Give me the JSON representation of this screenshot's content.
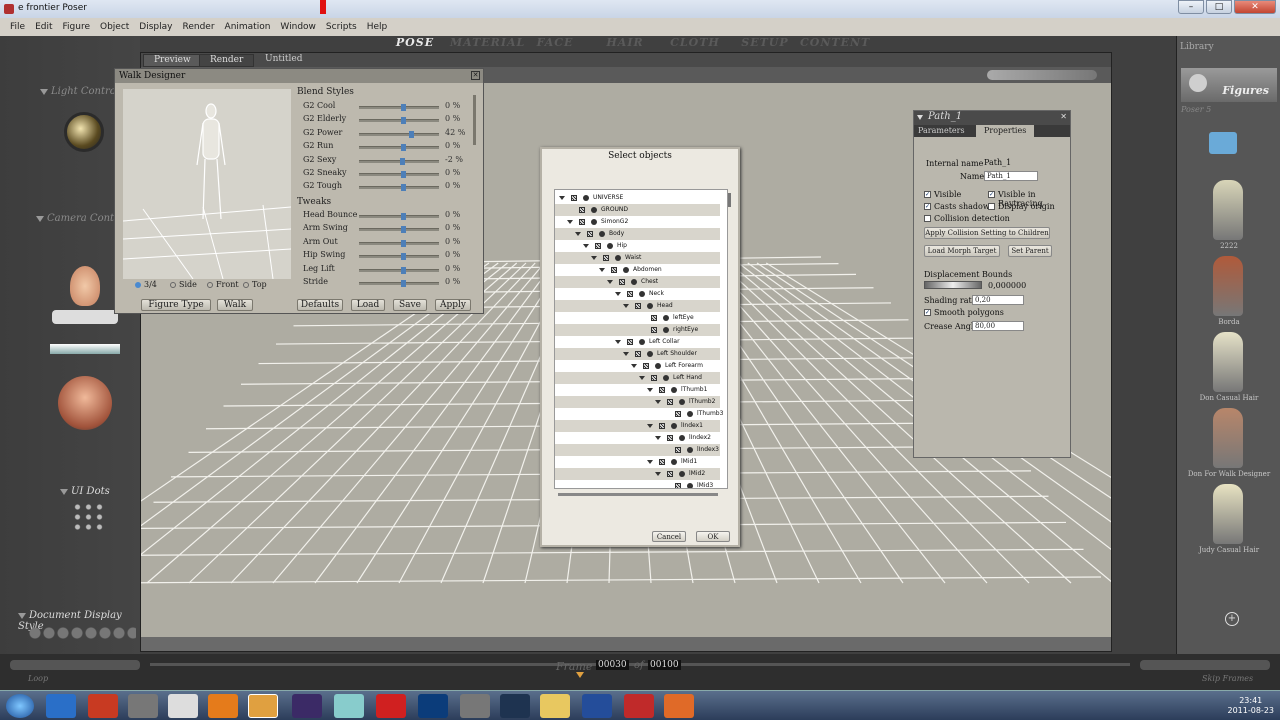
{
  "title_bar": {
    "title": "e frontier Poser",
    "minimize": "–",
    "maximize": "□",
    "close": "✕"
  },
  "menu": [
    "File",
    "Edit",
    "Figure",
    "Object",
    "Display",
    "Render",
    "Animation",
    "Window",
    "Scripts",
    "Help"
  ],
  "rooms": [
    {
      "label": "POSE",
      "active": true
    },
    {
      "label": "MATERIAL"
    },
    {
      "label": "FACE"
    },
    {
      "label": "HAIR"
    },
    {
      "label": "CLOTH"
    },
    {
      "label": "SETUP"
    },
    {
      "label": "CONTENT"
    }
  ],
  "left": {
    "light_controls": "Light Controls",
    "camera_controls": "Camera Controls",
    "ui_dots": "UI Dots",
    "document_display_style": "Document Display Style"
  },
  "doc": {
    "tab_preview": "Preview",
    "tab_render": "Render",
    "doc_title": "Untitled"
  },
  "walk": {
    "title": "Walk Designer",
    "blend_header": "Blend Styles",
    "blend": [
      {
        "label": "G2 Cool",
        "pct": "0 %",
        "level": 0.55
      },
      {
        "label": "G2 Elderly",
        "pct": "0 %",
        "level": 0.55
      },
      {
        "label": "G2 Power",
        "pct": "42 %",
        "level": 0.65
      },
      {
        "label": "G2 Run",
        "pct": "0 %",
        "level": 0.55
      },
      {
        "label": "G2 Sexy",
        "pct": "-2 %",
        "level": 0.54
      },
      {
        "label": "G2 Sneaky",
        "pct": "0 %",
        "level": 0.55
      },
      {
        "label": "G2 Tough",
        "pct": "0 %",
        "level": 0.55
      }
    ],
    "tweaks_header": "Tweaks",
    "tweaks": [
      {
        "label": "Head Bounce",
        "pct": "0 %",
        "level": 0.55
      },
      {
        "label": "Arm Swing",
        "pct": "0 %",
        "level": 0.55
      },
      {
        "label": "Arm Out",
        "pct": "0 %",
        "level": 0.55
      },
      {
        "label": "Hip Swing",
        "pct": "0 %",
        "level": 0.55
      },
      {
        "label": "Leg Lift",
        "pct": "0 %",
        "level": 0.55
      },
      {
        "label": "Stride",
        "pct": "0 %",
        "level": 0.55
      }
    ],
    "views": [
      "3/4",
      "Side",
      "Front",
      "Top"
    ],
    "buttons": {
      "figure_type": "Figure Type",
      "walk": "Walk",
      "defaults": "Defaults",
      "load": "Load",
      "save": "Save",
      "apply": "Apply"
    }
  },
  "dialog": {
    "title": "Select objects",
    "rows": [
      {
        "label": "UNIVERSE",
        "indent": 0,
        "expand": true
      },
      {
        "label": "GROUND",
        "indent": 1,
        "expand": false
      },
      {
        "label": "SimonG2",
        "indent": 1,
        "expand": true
      },
      {
        "label": "Body",
        "indent": 2,
        "expand": true
      },
      {
        "label": "Hip",
        "indent": 3,
        "expand": true
      },
      {
        "label": "Waist",
        "indent": 4,
        "expand": true
      },
      {
        "label": "Abdomen",
        "indent": 5,
        "expand": true
      },
      {
        "label": "Chest",
        "indent": 6,
        "expand": true
      },
      {
        "label": "Neck",
        "indent": 7,
        "expand": true
      },
      {
        "label": "Head",
        "indent": 8,
        "expand": true
      },
      {
        "label": "leftEye",
        "indent": 10,
        "expand": false
      },
      {
        "label": "rightEye",
        "indent": 10,
        "expand": false
      },
      {
        "label": "Left Collar",
        "indent": 7,
        "expand": true
      },
      {
        "label": "Left Shoulder",
        "indent": 8,
        "expand": true
      },
      {
        "label": "Left Forearm",
        "indent": 9,
        "expand": true
      },
      {
        "label": "Left Hand",
        "indent": 10,
        "expand": true
      },
      {
        "label": "lThumb1",
        "indent": 11,
        "expand": true
      },
      {
        "label": "lThumb2",
        "indent": 12,
        "expand": true
      },
      {
        "label": "lThumb3",
        "indent": 13,
        "expand": false
      },
      {
        "label": "lIndex1",
        "indent": 11,
        "expand": true
      },
      {
        "label": "lIndex2",
        "indent": 12,
        "expand": true
      },
      {
        "label": "lIndex3",
        "indent": 13,
        "expand": false
      },
      {
        "label": "lMid1",
        "indent": 11,
        "expand": true
      },
      {
        "label": "lMid2",
        "indent": 12,
        "expand": true
      },
      {
        "label": "lMid3",
        "indent": 13,
        "expand": false
      }
    ],
    "cancel": "Cancel",
    "ok": "OK"
  },
  "path_panel": {
    "title": "Path_1",
    "tab_parameters": "Parameters",
    "tab_properties": "Properties",
    "internal_name_label": "Internal name",
    "internal_name": "Path_1",
    "name_label": "Name",
    "name_value": "Path_1",
    "visible": "Visible",
    "visible_in_raytracing": "Visible in Raytracing",
    "casts_shadows": "Casts shadows",
    "display_origin": "Display origin",
    "collision_detection": "Collision detection",
    "apply_collision": "Apply Collision Setting to Children",
    "load_morph_target": "Load Morph Target",
    "set_parent": "Set Parent",
    "displacement_bounds": "Displacement Bounds",
    "displacement_value": "0,000000",
    "shading_rate_label": "Shading rate",
    "shading_rate": "0,20",
    "smooth_polygons": "Smooth polygons",
    "crease_angle_label": "Crease Angle",
    "crease_angle": "80,00"
  },
  "library": {
    "title": "Library",
    "category": "Figures",
    "section": "Poser 5",
    "items": [
      {
        "name": "2222"
      },
      {
        "name": "Borda"
      },
      {
        "name": "Don Casual Hair"
      },
      {
        "name": "Don For Walk Designer"
      },
      {
        "name": "Judy Casual Hair"
      }
    ]
  },
  "timeline": {
    "frame_label": "Frame",
    "frame": "00030",
    "of": "of",
    "total": "00100",
    "loop": "Loop",
    "skip_frames": "Skip Frames"
  },
  "taskbar": {
    "time": "23:41",
    "date": "2011-08-23"
  }
}
